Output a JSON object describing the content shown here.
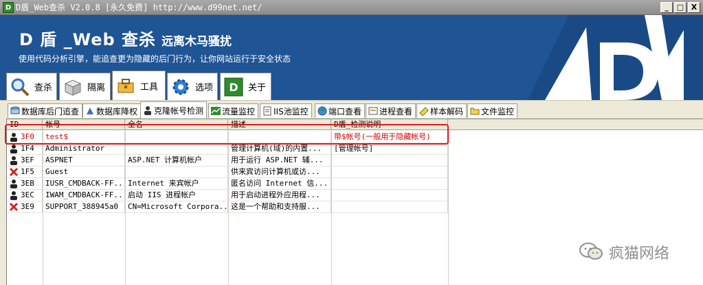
{
  "window": {
    "title": "D盾_Web查杀 V2.0.8 [永久免费] http://www.d99net.net/",
    "minimize": "_",
    "maximize": "□",
    "close": "X"
  },
  "banner": {
    "title": "D 盾 _Web 查杀",
    "subtitle": "远离木马骚扰",
    "slogan": "使用代码分析引擎，能追查更为隐藏的后门行为，让你网站运行于安全状态"
  },
  "main_tabs": [
    {
      "label": "查杀",
      "icon": "magnifier-icon"
    },
    {
      "label": "隔离",
      "icon": "box-icon"
    },
    {
      "label": "工具",
      "icon": "toolbox-icon"
    },
    {
      "label": "选项",
      "icon": "gear-icon"
    },
    {
      "label": "关于",
      "icon": "d-logo-icon"
    }
  ],
  "active_main_tab": "工具",
  "sub_tabs": [
    {
      "label": "数据库后门追查",
      "icon": "database-search-icon"
    },
    {
      "label": "数据库降权",
      "icon": "database-down-icon"
    },
    {
      "label": "克隆帐号检测",
      "icon": "user-clone-icon"
    },
    {
      "label": "流量监控",
      "icon": "traffic-icon"
    },
    {
      "label": "IIS池监控",
      "icon": "iis-pool-icon"
    },
    {
      "label": "端口查看",
      "icon": "globe-icon"
    },
    {
      "label": "进程查看",
      "icon": "process-icon"
    },
    {
      "label": "样本解码",
      "icon": "decode-icon"
    },
    {
      "label": "文件监控",
      "icon": "folder-icon"
    }
  ],
  "active_sub_tab": "克隆帐号检测",
  "table": {
    "columns": [
      "ID",
      "帐号",
      "全名",
      "描述",
      "D盾_检测说明"
    ],
    "rows": [
      {
        "icon": "user-icon",
        "id": "3F0",
        "account": "test$",
        "fullname": "",
        "desc": "",
        "note": "带$帐号(一般用于隐藏帐号)",
        "alert": true
      },
      {
        "icon": "user-icon",
        "id": "1F4",
        "account": "Administrator",
        "fullname": "",
        "desc": "管理计算机(域)的内置...",
        "note": "[管理帐号]",
        "alert": false
      },
      {
        "icon": "user-icon",
        "id": "3EF",
        "account": "ASPNET",
        "fullname": "ASP.NET 计算机帐户",
        "desc": "用于运行 ASP.NET 辅...",
        "note": "",
        "alert": false
      },
      {
        "icon": "disabled-user-icon",
        "id": "1F5",
        "account": "Guest",
        "fullname": "",
        "desc": "供来宾访问计算机或访...",
        "note": "",
        "alert": false
      },
      {
        "icon": "user-icon",
        "id": "3EB",
        "account": "IUSR_CMDBACK-FF...",
        "fullname": "Internet 来宾帐户",
        "desc": "匿名访问 Internet 信...",
        "note": "",
        "alert": false
      },
      {
        "icon": "user-icon",
        "id": "3EC",
        "account": "IWAM_CMDBACK-FF...",
        "fullname": "启动 IIS 进程帐户",
        "desc": "用于启动进程外应用程...",
        "note": "",
        "alert": false
      },
      {
        "icon": "disabled-user-icon",
        "id": "3E9",
        "account": "SUPPORT_388945a0",
        "fullname": "CN=Microsoft Corpora...",
        "desc": "这是一个帮助和支持服...",
        "note": "",
        "alert": false
      }
    ]
  },
  "watermark": {
    "text": "疯猫网络",
    "icon": "wechat-icon"
  },
  "colors": {
    "banner": "#1f5495",
    "alert": "#d40000",
    "highlight": "#e01818"
  }
}
